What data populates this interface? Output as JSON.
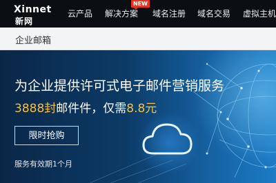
{
  "nav": {
    "logo_en": "Xinnet",
    "logo_cn": "新网",
    "items": [
      {
        "label": "云产品"
      },
      {
        "label": "解决方案",
        "badge": "NEW"
      },
      {
        "label": "域名注册"
      },
      {
        "label": "域名交易"
      },
      {
        "label": "虚拟主机"
      }
    ]
  },
  "subbar": {
    "title": "企业邮箱"
  },
  "hero": {
    "headline": "为企业提供许可式电子邮件营销服务",
    "offer_count": "3888封",
    "offer_mid": "邮件件，仅需",
    "offer_price": "8.8元",
    "button_label": "限时抢购",
    "validity": "服务有效期1个月"
  },
  "colors": {
    "accent": "#ffbf2f",
    "badge": "#e8341c",
    "nav_bg": "#0b0f14"
  },
  "icons": [
    "cloud-icon",
    "globe-network-icon"
  ]
}
